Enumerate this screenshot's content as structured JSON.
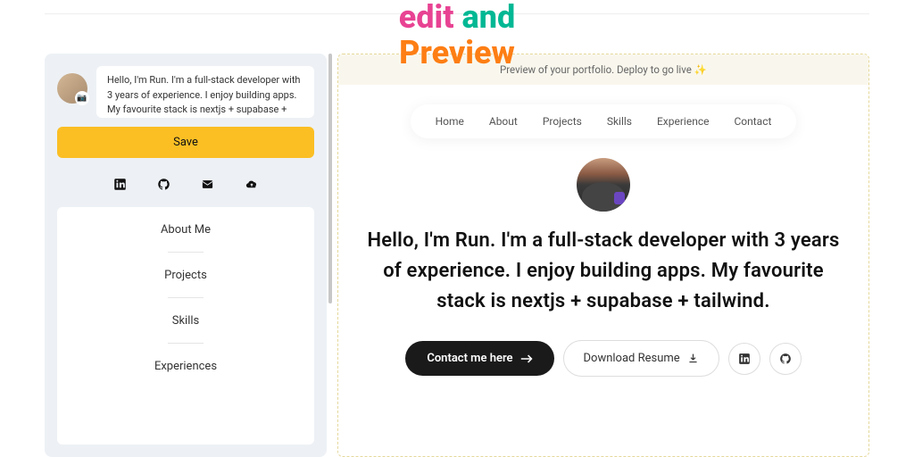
{
  "hero": {
    "w1": "edit",
    "w2": "and",
    "w3": "Preview"
  },
  "editor": {
    "intro_value": "Hello, I'm Run. I'm a full-stack developer with 3 years of experience. I enjoy building apps. My favourite stack is nextjs + supabase + tailwind.",
    "save_label": "Save",
    "sections": [
      "About Me",
      "Projects",
      "Skills",
      "Experiences"
    ]
  },
  "preview": {
    "banner": "Preview of your portfolio. Deploy to go live ✨",
    "nav": [
      "Home",
      "About",
      "Projects",
      "Skills",
      "Experience",
      "Contact"
    ],
    "intro": "Hello, I'm Run. I'm a full-stack developer with 3 years of experience. I enjoy building apps. My favourite stack is nextjs + supabase + tailwind.",
    "contact_label": "Contact me here",
    "resume_label": "Download Resume"
  }
}
